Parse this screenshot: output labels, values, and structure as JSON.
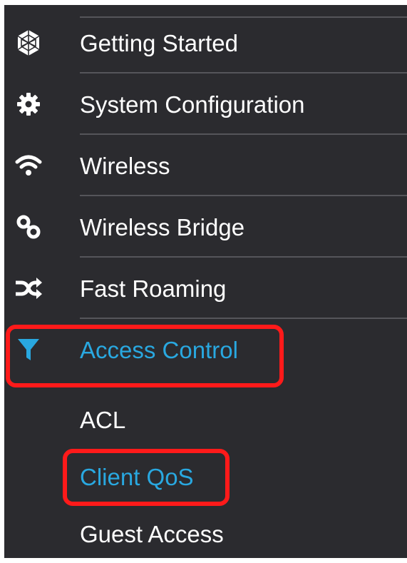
{
  "nav": {
    "items": [
      {
        "label": "Getting Started",
        "icon": "getting-started-icon"
      },
      {
        "label": "System Configuration",
        "icon": "gear-icon"
      },
      {
        "label": "Wireless",
        "icon": "wifi-icon"
      },
      {
        "label": "Wireless Bridge",
        "icon": "bridge-link-icon"
      },
      {
        "label": "Fast Roaming",
        "icon": "shuffle-icon"
      },
      {
        "label": "Access Control",
        "icon": "filter-icon",
        "active": true
      }
    ],
    "sub_items": [
      {
        "label": "ACL"
      },
      {
        "label": "Client QoS",
        "active": true
      },
      {
        "label": "Guest Access"
      }
    ]
  },
  "colors": {
    "sidebar_bg": "#2b2b2f",
    "text": "#ffffff",
    "active_text": "#29a8e0",
    "divider": "#55555a",
    "highlight": "#ff1a1a"
  }
}
